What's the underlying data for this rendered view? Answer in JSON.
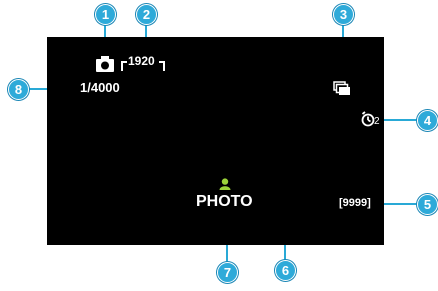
{
  "screen": {
    "mode_icon": "camera-icon",
    "image_size": "1920",
    "shutter_speed": "1/4000",
    "shooting_mode_icon": "continuous-shooting-icon",
    "self_timer_icon": "self-timer-icon",
    "self_timer_value": "2",
    "remaining_shots": "[9999]",
    "touch_priority_icon": "face-priority-icon",
    "record_mode_label": "PHOTO"
  },
  "callouts": [
    "1",
    "2",
    "3",
    "4",
    "5",
    "6",
    "7",
    "8"
  ],
  "colors": {
    "callout": "#2eaad9",
    "accent_green": "#9bd43a",
    "screen_bg": "#000000",
    "text": "#ffffff"
  }
}
